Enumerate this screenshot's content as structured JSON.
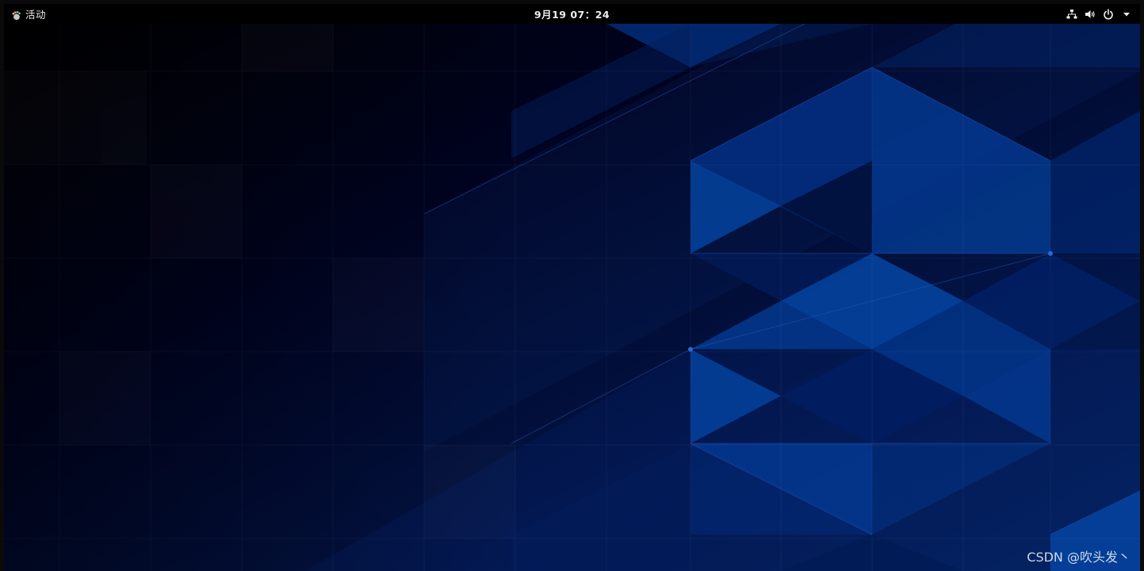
{
  "topbar": {
    "activities_label": "活动",
    "clock": "9月19 07：24",
    "status_icons": [
      "network-wired-icon",
      "volume-icon",
      "power-icon",
      "chevron-down-icon"
    ]
  },
  "watermark": "CSDN @吹头发丶",
  "colors": {
    "panel": "#000000",
    "wallpaper_dark": "#01041a",
    "wallpaper_blue": "#003a8c",
    "panel_text": "#eeeeec"
  }
}
